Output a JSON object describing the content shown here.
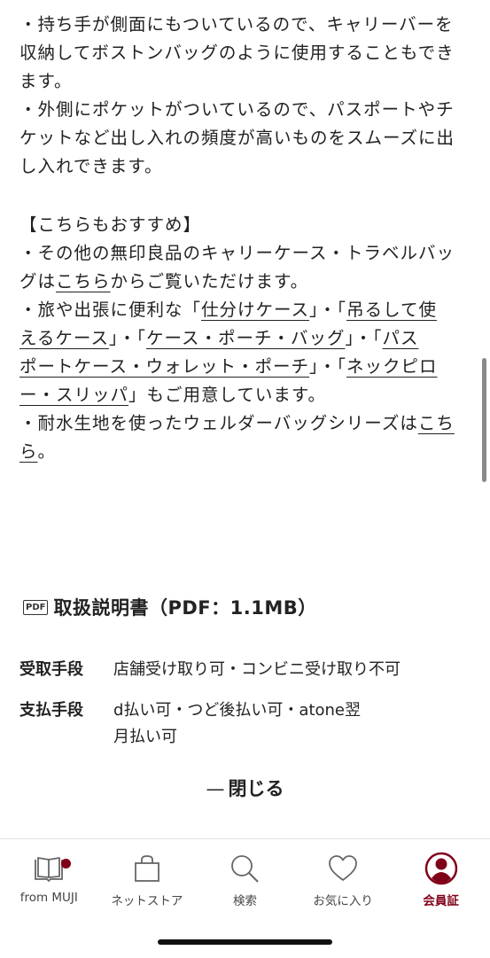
{
  "description": {
    "bullet1": {
      "line1": "・持ち手が側面にもついているので、キャリーバーを",
      "line2": "収納してボストンバッグのように使用することもでき",
      "line3": "ます。"
    },
    "bullet2": {
      "line1": "・外側にポケットがついているので、パスポートやチ",
      "line2": "ケットなど出し入れの頻度が高いものをスムーズに出",
      "line3": "し入れできます。"
    },
    "recommend_heading": "【こちらもおすすめ】",
    "rec1": {
      "line1": "・その他の無印良品のキャリーケース・トラベルバッ",
      "line2_pre": "グは",
      "line2_link": "こちら",
      "line2_post": "からご覧いただけます。"
    },
    "rec2": {
      "line1_pre": "・旅や出張に便利な「",
      "link_shiwake": "仕分けケース",
      "line1_mid": "」・「",
      "link_tsurushite_a": "吊るして使",
      "link_tsurushite_b": "えるケース",
      "line2_mid1": "」・「",
      "link_case_pouch": "ケース・ポーチ・バッグ",
      "line2_mid2": "」・「",
      "link_passport_a": "パス",
      "link_passport_b": "ポートケース・ウォレット・ポーチ",
      "line3_mid": "」・「",
      "link_neck_a": "ネックピロ",
      "link_neck_b": "ー・スリッパ",
      "line4_post": "」もご用意しています。"
    },
    "rec3": {
      "line1_pre": "・耐水生地を使ったウェルダーバッグシリーズは",
      "link_a": "こち",
      "link_b": "ら",
      "line2_post": "。"
    }
  },
  "manual": {
    "badge": "PDF",
    "title": "取扱説明書（PDF：1.1MB）"
  },
  "specs": [
    {
      "label": "受取手段",
      "value": "店舗受け取り可・コンビニ受け取り不可"
    },
    {
      "label": "支払手段",
      "value": "d払い可・つど後払い可・atone翌月払い可"
    }
  ],
  "close": {
    "dash": "—",
    "label": "閉じる"
  },
  "tabbar": {
    "items": [
      {
        "label": "from MUJI",
        "icon": "book-icon"
      },
      {
        "label": "ネットストア",
        "icon": "shopping-bag-icon"
      },
      {
        "label": "検索",
        "icon": "search-icon"
      },
      {
        "label": "お気に入り",
        "icon": "heart-icon"
      },
      {
        "label": "会員証",
        "icon": "member-card-icon"
      }
    ],
    "accent_color": "#7f0019"
  }
}
